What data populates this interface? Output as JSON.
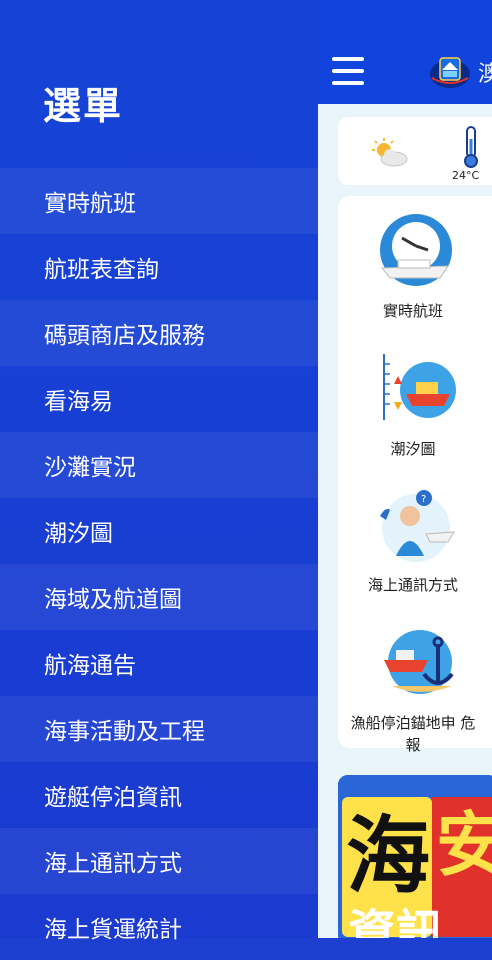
{
  "drawer": {
    "title": "選單",
    "items": [
      {
        "label": "實時航班"
      },
      {
        "label": "航班表查詢"
      },
      {
        "label": "碼頭商店及服務"
      },
      {
        "label": "看海易"
      },
      {
        "label": "沙灘實況"
      },
      {
        "label": "潮汐圖"
      },
      {
        "label": "海域及航道圖"
      },
      {
        "label": "航海通告"
      },
      {
        "label": "海事活動及工程"
      },
      {
        "label": "遊艇停泊資訊"
      },
      {
        "label": "海上通訊方式"
      },
      {
        "label": "海上貨運統計"
      }
    ]
  },
  "app": {
    "title_fragment": "澳",
    "weather": {
      "temperature": "24°C"
    },
    "tiles": [
      {
        "label": "實時航班"
      },
      {
        "label": "潮汐圖"
      },
      {
        "label": "海上通訊方式"
      },
      {
        "label_line1": "漁船停泊錨地申 危",
        "label_line2": "報"
      }
    ],
    "banner": {
      "text_big": "海",
      "text_red": "安",
      "text_bottom": "資訊"
    }
  },
  "colors": {
    "drawer_bg": "#1643d6",
    "header_bg": "#1144dc",
    "app_bg": "#eaf4fb",
    "banner_red": "#e0322a",
    "banner_yellow": "#ffe14a"
  }
}
